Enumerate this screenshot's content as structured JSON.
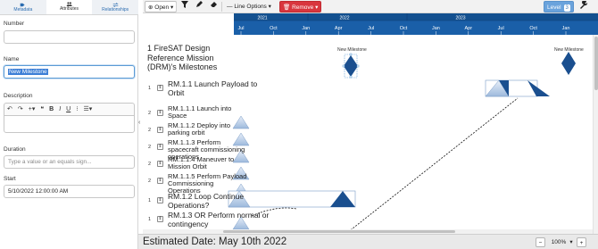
{
  "left_panel": {
    "tabs": [
      {
        "label": "Metadata",
        "icon": "tags-icon"
      },
      {
        "label": "Attributes",
        "icon": "people-icon"
      },
      {
        "label": "Relationships",
        "icon": "arrows-icon"
      }
    ],
    "number": {
      "label": "Number",
      "value": ""
    },
    "name": {
      "label": "Name",
      "value": "New Milestone"
    },
    "description": {
      "label": "Description",
      "toolbar": [
        "↶",
        "↷",
        "+▾",
        "❝",
        "B",
        "I",
        "U",
        "⁝",
        "☰▾"
      ]
    },
    "duration": {
      "label": "Duration",
      "placeholder": "Type a value or an equals sign..."
    },
    "start": {
      "label": "Start",
      "value": "5/10/2022 12:00:00 AM"
    },
    "collapse": "‹"
  },
  "toolbar": {
    "open_label": "Open",
    "line_options_label": "Line Options",
    "remove_label": "Remove",
    "level_label": "Level",
    "level_value": "3"
  },
  "timeline": {
    "years": [
      "2021",
      "2022",
      "2023"
    ],
    "months": [
      "Jul",
      "Oct",
      "Jan",
      "Apr",
      "Jul",
      "Oct",
      "Jan",
      "Apr",
      "Jul",
      "Oct",
      "Jan"
    ],
    "milestone_labels": [
      "New Milestone",
      "New Milestone"
    ],
    "colors": {
      "header": "#1a5fa8",
      "header_dark": "#0f3f75",
      "milestone": "#1a4f8f",
      "triangle": "#aac4e4"
    }
  },
  "gantt": {
    "title": "1 FireSAT Design Reference Mission (DRM)'s Milestones",
    "rows": [
      {
        "num": "1",
        "label": "RM.1.1 Launch Payload to Orbit",
        "big": true
      },
      {
        "num": "2",
        "label": "RM.1.1.1 Launch into Space"
      },
      {
        "num": "2",
        "label": "RM.1.1.2 Deploy into parking orbit"
      },
      {
        "num": "2",
        "label": "RM.1.1.3 Perform spacecraft commissioning operations"
      },
      {
        "num": "2",
        "label": "RM.1.1.4 Maneuver to Mission Orbit"
      },
      {
        "num": "2",
        "label": "RM.1.1.5 Perform Payload Commissioning Operations"
      },
      {
        "num": "1",
        "label": "RM.1.2 Loop Continue Operations?",
        "big": true
      },
      {
        "num": "1",
        "label": "RM.1.3 OR Perform normal or contingency",
        "big": true
      }
    ]
  },
  "footer": {
    "estimate": "Estimated Date: May 10th 2022",
    "zoom_out": "−",
    "zoom_level": "100%",
    "zoom_in": "+"
  }
}
